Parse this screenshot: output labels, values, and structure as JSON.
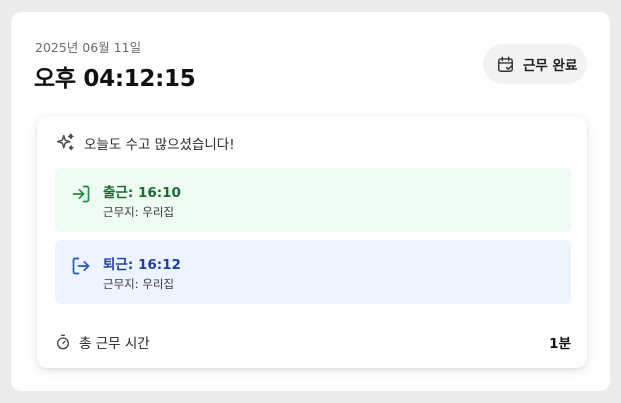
{
  "header": {
    "date": "2025년 06월 11일",
    "time": "오후 04:12:15",
    "status_label": "근무 완료",
    "status_icon": "calendar-check-icon"
  },
  "message": {
    "text": "오늘도 수고 많으셨습니다!",
    "icon": "sparkles-icon"
  },
  "entries": [
    {
      "title": "출근: 16:10",
      "location": "근무지: 우리집",
      "icon": "log-in-icon",
      "color": "#1e8c46",
      "background": "#eefcf2"
    },
    {
      "title": "퇴근: 16:12",
      "location": "근무지: 우리집",
      "icon": "log-out-icon",
      "color": "#2553c9",
      "background": "#eef4ff"
    }
  ],
  "total": {
    "label": "총 근무 시간",
    "value": "1분",
    "icon": "timer-icon"
  }
}
